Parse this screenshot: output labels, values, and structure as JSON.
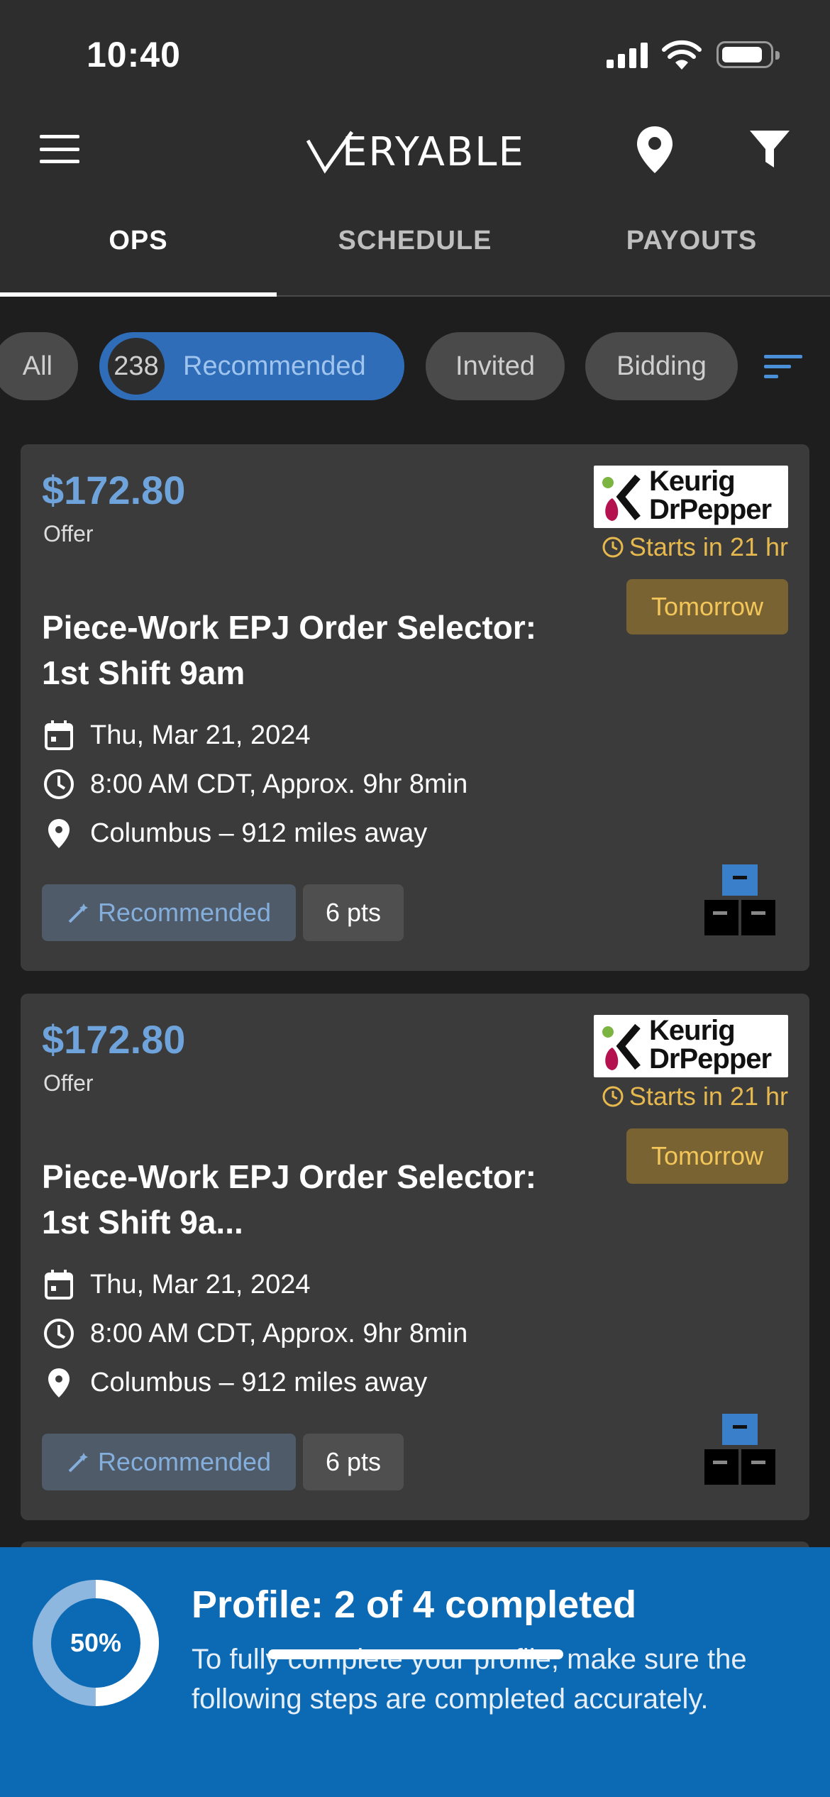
{
  "status_bar": {
    "time": "10:40"
  },
  "header": {
    "logo_text": "ERYABLE"
  },
  "tabs": [
    {
      "label": "OPS",
      "active": true
    },
    {
      "label": "SCHEDULE",
      "active": false
    },
    {
      "label": "PAYOUTS",
      "active": false
    }
  ],
  "filters": {
    "all_label": "All",
    "recommended_count": "238",
    "recommended_label": "Recommended",
    "invited_label": "Invited",
    "bidding_label": "Bidding"
  },
  "cards": [
    {
      "price": "$172.80",
      "price_label": "Offer",
      "brand_line1": "Keurig",
      "brand_line2": "DrPepper",
      "starts": "Starts in 21 hr",
      "day_badge": "Tomorrow",
      "title": "Piece-Work EPJ Order Selector: 1st Shift 9am",
      "date": "Thu, Mar 21, 2024",
      "time": "8:00 AM CDT, Approx. 9hr 8min",
      "location": "Columbus – 912 miles away",
      "tag": "Recommended",
      "points": "6 pts"
    },
    {
      "price": "$172.80",
      "price_label": "Offer",
      "brand_line1": "Keurig",
      "brand_line2": "DrPepper",
      "starts": "Starts in 21 hr",
      "day_badge": "Tomorrow",
      "title": "Piece-Work EPJ Order Selector: 1st Shift 9a...",
      "date": "Thu, Mar 21, 2024",
      "time": "8:00 AM CDT, Approx. 9hr 8min",
      "location": "Columbus – 912 miles away",
      "tag": "Recommended",
      "points": "6 pts"
    }
  ],
  "profile": {
    "percent_label": "50%",
    "progress": 0.5,
    "title": "Profile: 2 of 4 completed",
    "description": "To fully complete your profile, make sure the following steps are completed accurately."
  },
  "colors": {
    "accent_blue": "#2f6db8",
    "price_blue": "#6fa3db",
    "warning_gold": "#e6b84e",
    "banner_blue": "#0c6ab4"
  }
}
